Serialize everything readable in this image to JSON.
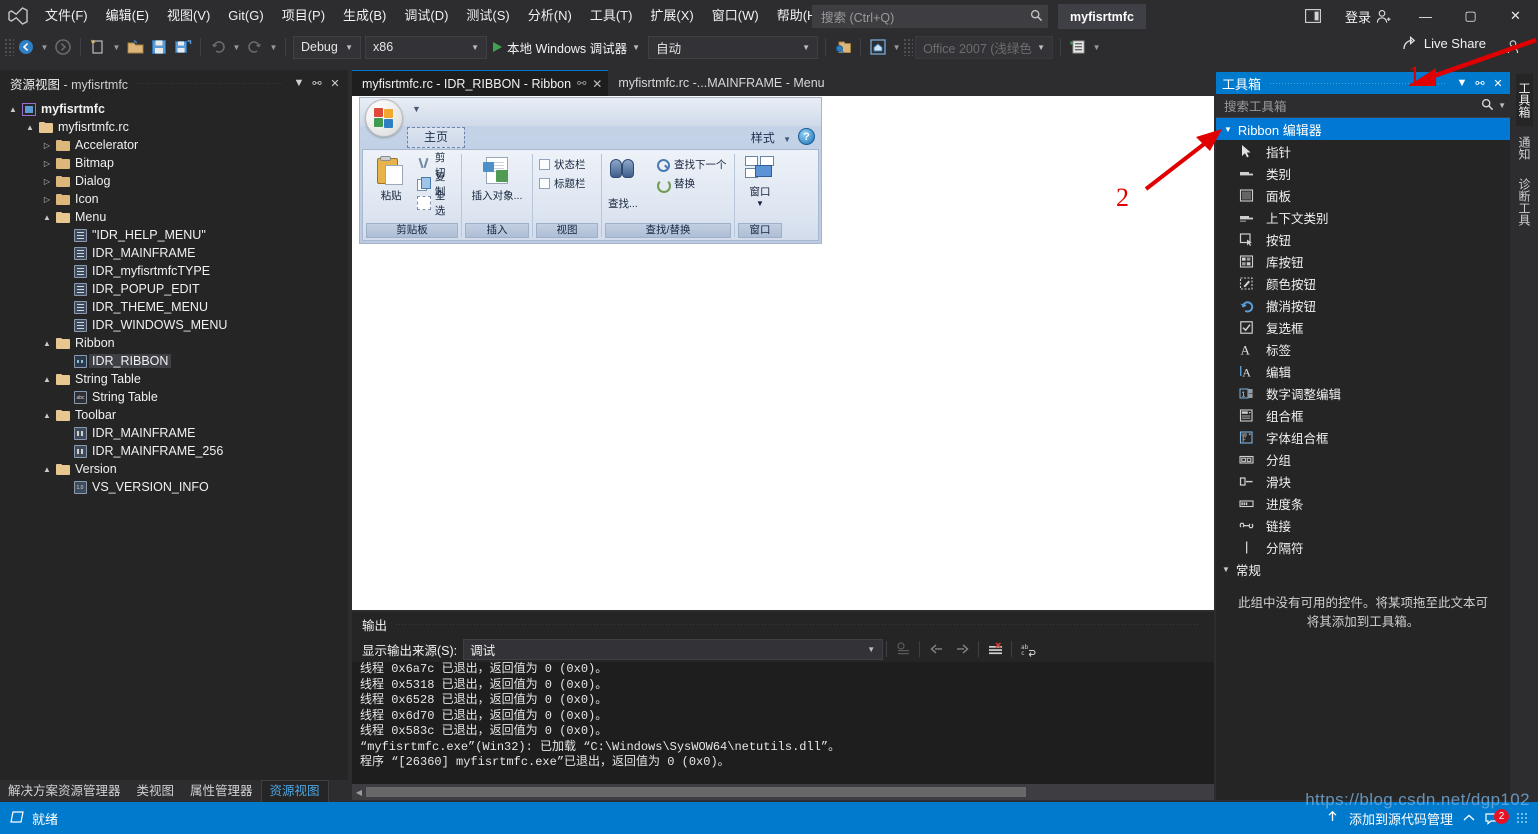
{
  "window": {
    "project_chip": "myfisrtmfc",
    "signin_label": "登录",
    "minimize": "—",
    "maximize": "▢",
    "close": "✕"
  },
  "menubar": {
    "items": [
      {
        "label": "文件(F)"
      },
      {
        "label": "编辑(E)"
      },
      {
        "label": "视图(V)"
      },
      {
        "label": "Git(G)"
      },
      {
        "label": "项目(P)"
      },
      {
        "label": "生成(B)"
      },
      {
        "label": "调试(D)"
      },
      {
        "label": "测试(S)"
      },
      {
        "label": "分析(N)"
      },
      {
        "label": "工具(T)"
      },
      {
        "label": "扩展(X)"
      },
      {
        "label": "窗口(W)"
      },
      {
        "label": "帮助(H)"
      }
    ]
  },
  "search": {
    "placeholder": "搜索 (Ctrl+Q)"
  },
  "toolbar": {
    "config": "Debug",
    "platform": "x86",
    "debug_target": "本地 Windows 调试器",
    "auto": "自动",
    "theme_combo": "Office 2007 (浅绿色)",
    "live_share": "Live Share"
  },
  "resource_view": {
    "title_prefix": "资源视图",
    "title_sep": " - ",
    "title_project": "myfisrtmfc",
    "tree": [
      {
        "label": "myfisrtmfc",
        "depth": 0,
        "icon": "project-icon",
        "expander": "▲",
        "selected": false,
        "bold": true
      },
      {
        "label": "myfisrtmfc.rc",
        "depth": 1,
        "icon": "folder-open",
        "expander": "▲",
        "selected": false
      },
      {
        "label": "Accelerator",
        "depth": 2,
        "icon": "folder",
        "expander": "▷",
        "selected": false
      },
      {
        "label": "Bitmap",
        "depth": 2,
        "icon": "folder",
        "expander": "▷",
        "selected": false
      },
      {
        "label": "Dialog",
        "depth": 2,
        "icon": "folder",
        "expander": "▷",
        "selected": false
      },
      {
        "label": "Icon",
        "depth": 2,
        "icon": "folder",
        "expander": "▷",
        "selected": false
      },
      {
        "label": "Menu",
        "depth": 2,
        "icon": "folder-open",
        "expander": "▲",
        "selected": false
      },
      {
        "label": "\"IDR_HELP_MENU\"",
        "depth": 3,
        "icon": "resource-menu",
        "expander": "",
        "selected": false
      },
      {
        "label": "IDR_MAINFRAME",
        "depth": 3,
        "icon": "resource-menu",
        "expander": "",
        "selected": false
      },
      {
        "label": "IDR_myfisrtmfcTYPE",
        "depth": 3,
        "icon": "resource-menu",
        "expander": "",
        "selected": false
      },
      {
        "label": "IDR_POPUP_EDIT",
        "depth": 3,
        "icon": "resource-menu",
        "expander": "",
        "selected": false
      },
      {
        "label": "IDR_THEME_MENU",
        "depth": 3,
        "icon": "resource-menu",
        "expander": "",
        "selected": false
      },
      {
        "label": "IDR_WINDOWS_MENU",
        "depth": 3,
        "icon": "resource-menu",
        "expander": "",
        "selected": false
      },
      {
        "label": "Ribbon",
        "depth": 2,
        "icon": "folder-open",
        "expander": "▲",
        "selected": false
      },
      {
        "label": "IDR_RIBBON",
        "depth": 3,
        "icon": "resource-ribbon",
        "expander": "",
        "selected": true
      },
      {
        "label": "String Table",
        "depth": 2,
        "icon": "folder-open",
        "expander": "▲",
        "selected": false
      },
      {
        "label": "String Table",
        "depth": 3,
        "icon": "resource-string",
        "expander": "",
        "selected": false
      },
      {
        "label": "Toolbar",
        "depth": 2,
        "icon": "folder-open",
        "expander": "▲",
        "selected": false
      },
      {
        "label": "IDR_MAINFRAME",
        "depth": 3,
        "icon": "resource-toolbar",
        "expander": "",
        "selected": false
      },
      {
        "label": "IDR_MAINFRAME_256",
        "depth": 3,
        "icon": "resource-toolbar",
        "expander": "",
        "selected": false
      },
      {
        "label": "Version",
        "depth": 2,
        "icon": "folder-open",
        "expander": "▲",
        "selected": false
      },
      {
        "label": "VS_VERSION_INFO",
        "depth": 3,
        "icon": "resource-version",
        "expander": "",
        "selected": false
      }
    ],
    "bottom_tabs": [
      {
        "label": "解决方案资源管理器",
        "active": false
      },
      {
        "label": "类视图",
        "active": false
      },
      {
        "label": "属性管理器",
        "active": false
      },
      {
        "label": "资源视图",
        "active": true
      }
    ]
  },
  "document_tabs": [
    {
      "label": "myfisrtmfc.rc - IDR_RIBBON - Ribbon",
      "active": true,
      "pin": "⚯",
      "close": "✕"
    },
    {
      "label": "myfisrtmfc.rc -...MAINFRAME - Menu",
      "active": false,
      "pin": "",
      "close": ""
    }
  ],
  "ribbon_designer": {
    "tab_label": "主页",
    "style_label": "样式",
    "help_label": "?",
    "groups": [
      {
        "caption": "剪贴板",
        "big": [
          {
            "label": "粘贴",
            "icon": "paste-icon"
          }
        ],
        "small": [
          {
            "label": "剪切",
            "icon": "cut-icon"
          },
          {
            "label": "复制",
            "icon": "copy-icon"
          },
          {
            "label": "全选",
            "icon": "select-all-icon"
          }
        ]
      },
      {
        "caption": "插入",
        "big": [
          {
            "label": "插入对象...",
            "icon": "insert-object-icon"
          }
        ],
        "small": []
      },
      {
        "caption": "视图",
        "checkboxes": [
          {
            "label": "状态栏",
            "checked": false
          },
          {
            "label": "标题栏",
            "checked": false
          }
        ]
      },
      {
        "caption": "查找/替换",
        "big": [
          {
            "label": "查找...",
            "icon": "find-icon"
          }
        ],
        "small": [
          {
            "label": "查找下一个",
            "icon": "find-next-icon"
          },
          {
            "label": "替换",
            "icon": "replace-icon"
          }
        ]
      },
      {
        "caption": "窗口",
        "big": [
          {
            "label": "窗口",
            "icon": "window-icon",
            "dropdown": "▼"
          }
        ],
        "small": []
      }
    ]
  },
  "output": {
    "title": "输出",
    "source_label": "显示输出来源(S):",
    "source_value": "调试",
    "lines": [
      "线程 0x6a7c 已退出，返回值为 0 (0x0)。",
      "线程 0x5318 已退出，返回值为 0 (0x0)。",
      "线程 0x6528 已退出，返回值为 0 (0x0)。",
      "线程 0x6d70 已退出，返回值为 0 (0x0)。",
      "线程 0x583c 已退出，返回值为 0 (0x0)。",
      "“myfisrtmfc.exe”(Win32): 已加载 “C:\\Windows\\SysWOW64\\netutils.dll”。",
      "程序 “[26360] myfisrtmfc.exe”已退出，返回值为 0 (0x0)。"
    ]
  },
  "toolbox": {
    "title": "工具箱",
    "search_placeholder": "搜索工具箱",
    "group_label": "Ribbon 编辑器",
    "items": [
      {
        "label": "指针",
        "icon": "pointer-icon"
      },
      {
        "label": "类别",
        "icon": "category-icon"
      },
      {
        "label": "面板",
        "icon": "panel-icon"
      },
      {
        "label": "上下文类别",
        "icon": "context-category-icon"
      },
      {
        "label": "按钮",
        "icon": "button-icon"
      },
      {
        "label": "库按钮",
        "icon": "gallery-button-icon"
      },
      {
        "label": "颜色按钮",
        "icon": "color-button-icon"
      },
      {
        "label": "撤消按钮",
        "icon": "undo-button-icon"
      },
      {
        "label": "复选框",
        "icon": "checkbox-icon"
      },
      {
        "label": "标签",
        "icon": "label-icon"
      },
      {
        "label": "编辑",
        "icon": "edit-icon"
      },
      {
        "label": "数字调整编辑",
        "icon": "spin-edit-icon"
      },
      {
        "label": "组合框",
        "icon": "combobox-icon"
      },
      {
        "label": "字体组合框",
        "icon": "font-combobox-icon"
      },
      {
        "label": "分组",
        "icon": "group-icon"
      },
      {
        "label": "滑块",
        "icon": "slider-icon"
      },
      {
        "label": "进度条",
        "icon": "progressbar-icon"
      },
      {
        "label": "链接",
        "icon": "link-icon"
      },
      {
        "label": "分隔符",
        "icon": "separator-icon"
      }
    ],
    "general_group": "常规",
    "empty_message": "此组中没有可用的控件。将某项拖至此文本可将其添加到工具箱。"
  },
  "vertical_tabs": [
    {
      "label": "工具箱",
      "active": true
    },
    {
      "label": "通知",
      "active": false
    },
    {
      "label": "诊断工具",
      "active": false
    }
  ],
  "statusbar": {
    "ready": "就绪",
    "source_control": "添加到源代码管理",
    "notification_count": "2"
  },
  "annotations": [
    {
      "number": "1"
    },
    {
      "number": "2"
    }
  ],
  "watermark": "https://blog.csdn.net/dgp102",
  "colors": {
    "accent": "#007acc",
    "group_header": "#0078d4",
    "status_bar": "#007acc",
    "annotation_red": "#e00000",
    "shell_bg": "#2d2d30",
    "panel_bg": "#252526",
    "editor_bg": "#ffffff"
  }
}
